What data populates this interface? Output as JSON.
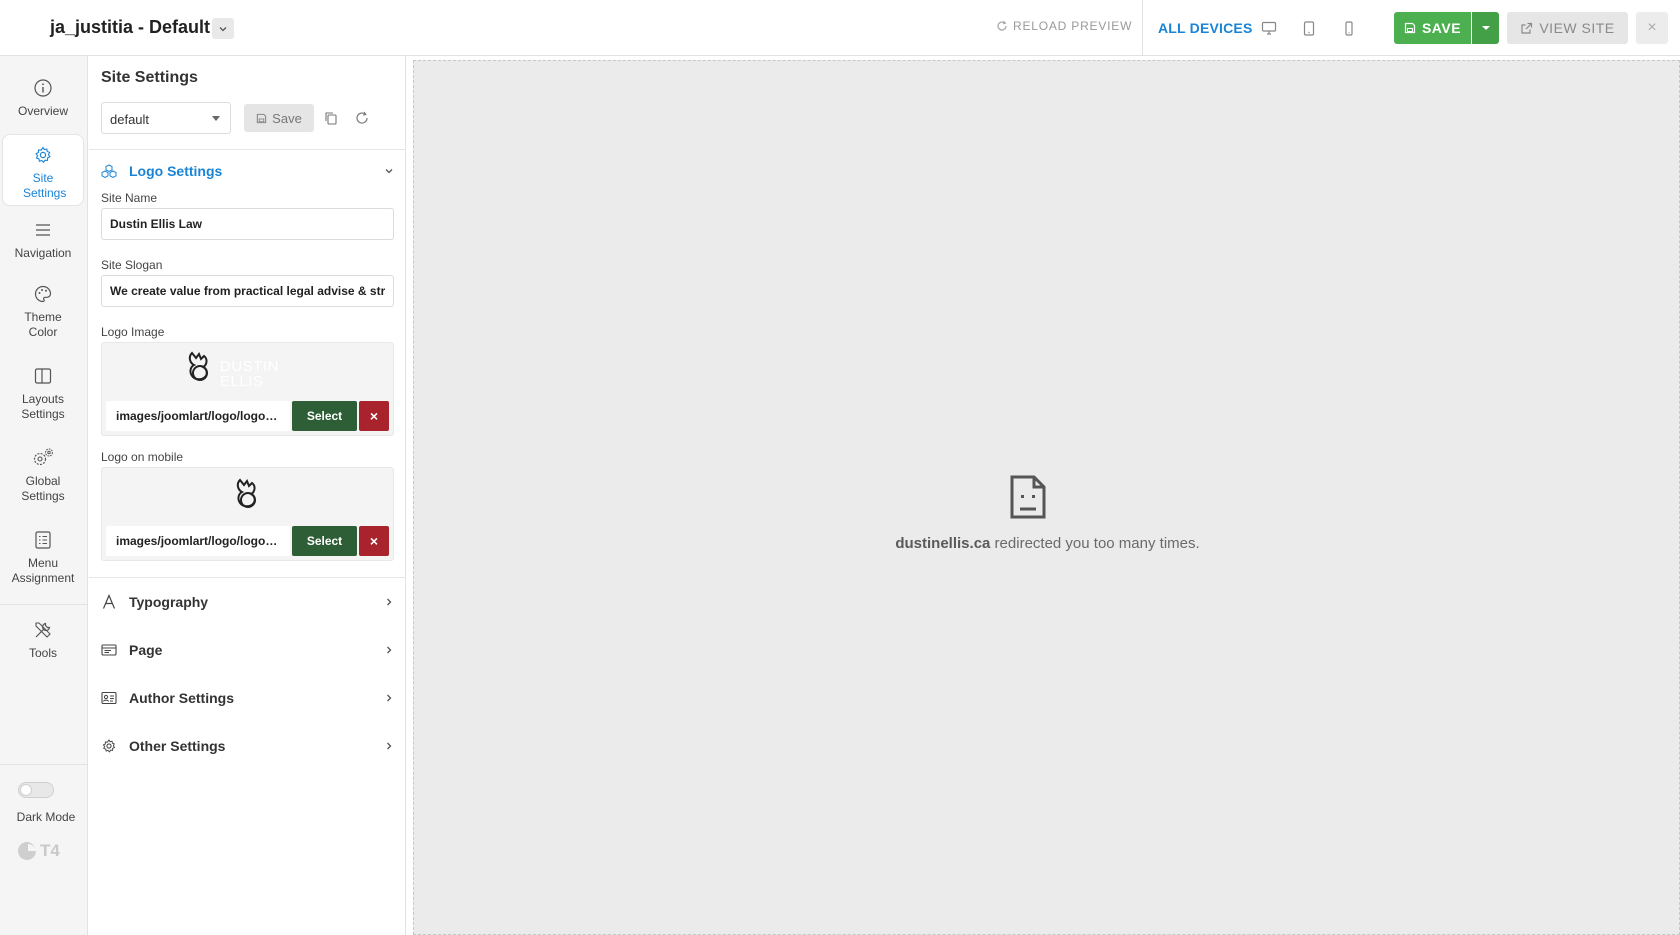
{
  "header": {
    "title": "ja_justitia - Default",
    "reload_label": "RELOAD PREVIEW",
    "devices_label": "ALL DEVICES",
    "save_label": "SAVE",
    "view_site_label": "VIEW SITE",
    "close_label": "×"
  },
  "nav": {
    "items": [
      {
        "label": "Overview",
        "icon": "info-icon"
      },
      {
        "label": "Site Settings",
        "icon": "gear-icon",
        "active": true
      },
      {
        "label": "Navigation",
        "icon": "menu-icon"
      },
      {
        "label": "Theme Color",
        "icon": "palette-icon"
      },
      {
        "label": "Layouts Settings",
        "icon": "layout-icon"
      },
      {
        "label": "Global Settings",
        "icon": "gears-icon"
      },
      {
        "label": "Menu Assignment",
        "icon": "list-icon"
      },
      {
        "label": "Tools",
        "icon": "tools-icon"
      }
    ],
    "dark_mode_label": "Dark Mode",
    "dark_mode_on": false,
    "brand_text": "T4"
  },
  "panel": {
    "title": "Site Settings",
    "profile_value": "default",
    "save_label": "Save",
    "logo_section": {
      "title": "Logo Settings",
      "site_name_label": "Site Name",
      "site_name_value": "Dustin Ellis Law",
      "slogan_label": "Site Slogan",
      "slogan_value": "We create value from practical legal advise & strong",
      "logo_image_label": "Logo Image",
      "logo_image_path": "images/joomlart/logo/logo.png",
      "logo_mobile_label": "Logo on mobile",
      "logo_mobile_path": "images/joomlart/logo/logo-mobile.png",
      "select_label": "Select",
      "remove_label": "×",
      "logo_wordmark_1": "DUSTIN",
      "logo_wordmark_2": "ELLIS"
    },
    "sections": [
      {
        "title": "Typography",
        "icon": "typography-icon"
      },
      {
        "title": "Page",
        "icon": "page-icon"
      },
      {
        "title": "Author Settings",
        "icon": "author-card-icon"
      },
      {
        "title": "Other Settings",
        "icon": "cog-icon"
      }
    ]
  },
  "preview": {
    "error_domain": "dustinellis.ca",
    "error_message": " redirected you too many times."
  },
  "colors": {
    "accent": "#1a84d6",
    "save_green": "#4caf50",
    "select_green": "#2e5e36",
    "remove_red": "#a8232b"
  }
}
